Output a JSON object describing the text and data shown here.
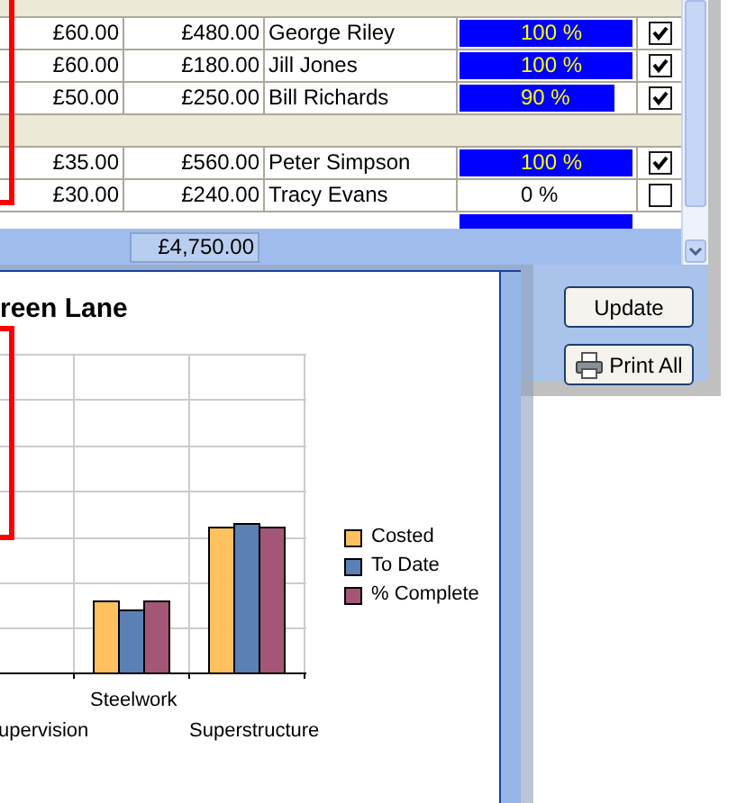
{
  "grid": {
    "rows": [
      {
        "kind": "group"
      },
      {
        "kind": "item",
        "column_1": "£60.00",
        "column_2": "£480.00",
        "column_3": "George Riley",
        "level": 1,
        "reading": "100 %",
        "checked": true
      },
      {
        "kind": "item",
        "column_1": "£60.00",
        "column_2": "£180.00",
        "column_3": "Jill Jones",
        "level": 1,
        "reading": "100 %",
        "checked": true
      },
      {
        "kind": "item",
        "column_1": "£50.00",
        "column_2": "£250.00",
        "column_3": "Bill Richards",
        "level": 0.9,
        "reading": "90 %",
        "checked": true
      },
      {
        "kind": "group"
      },
      {
        "kind": "item",
        "column_1": "£35.00",
        "column_2": "£560.00",
        "column_3": "Peter Simpson",
        "level": 1,
        "reading": "100 %",
        "checked": true
      },
      {
        "kind": "item",
        "column_1": "£30.00",
        "column_2": "£240.00",
        "column_3": "Tracy Evans",
        "level": 0,
        "reading": "0 %",
        "checked": false
      }
    ]
  },
  "totals": {
    "column_2": "£4,750.00"
  },
  "buttons": [
    {
      "label": "Update",
      "kind": "plain"
    },
    {
      "label": "Print All",
      "kind": "print"
    }
  ],
  "chart": {
    "title": "reen Lane",
    "categories": [
      "upervision",
      "Steelwork",
      "Superstructure"
    ],
    "legend": [
      {
        "label": "Costed",
        "color": "#ffc060"
      },
      {
        "label": "To Date",
        "color": "#5b80b4"
      },
      {
        "label": "% Complete",
        "color": "#a45676"
      }
    ]
  }
}
